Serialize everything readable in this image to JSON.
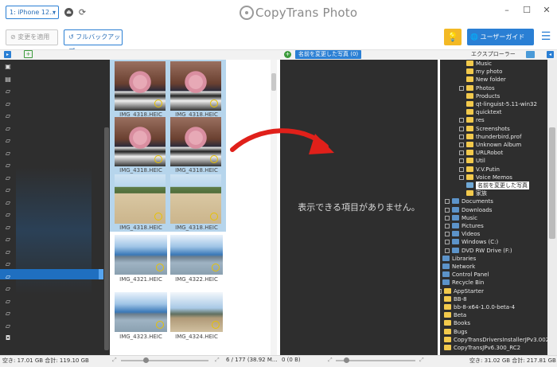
{
  "titlebar": {
    "device_selector": "1: iPhone 12...",
    "app_title": "CopyTrans Photo"
  },
  "toolbar": {
    "apply_changes": "変更を適用",
    "full_backup": "フルバックアップ",
    "user_guide": "ユーザーガイド"
  },
  "headers": {
    "renamed_photos_tab": "名前を変更した写真",
    "renamed_photos_count": "(0)",
    "explorer_label": "エクスプローラー"
  },
  "photos": [
    {
      "name": "IMG_4318.HEIC",
      "type": "flowers",
      "selected": true
    },
    {
      "name": "IMG_4318.HEIC",
      "type": "flowers",
      "selected": true
    },
    {
      "name": "IMG_4318.HEIC",
      "type": "flowers",
      "selected": true
    },
    {
      "name": "IMG_4318.HEIC",
      "type": "flowers",
      "selected": true
    },
    {
      "name": "IMG_4318.HEIC",
      "type": "beach",
      "selected": true
    },
    {
      "name": "IMG_4318.HEIC",
      "type": "beach",
      "selected": true
    },
    {
      "name": "IMG_4321.HEIC",
      "type": "sea",
      "selected": false
    },
    {
      "name": "IMG_4322.HEIC",
      "type": "sea",
      "selected": false
    },
    {
      "name": "IMG_4323.HEIC",
      "type": "sea",
      "selected": false
    },
    {
      "name": "IMG_4324.HEIC",
      "type": "path",
      "selected": false
    }
  ],
  "center": {
    "empty_message": "表示できる項目がありません。"
  },
  "explorer_tree": [
    {
      "label": "Music",
      "icon": "folder"
    },
    {
      "label": "my photo",
      "icon": "folder"
    },
    {
      "label": "New folder",
      "icon": "folder"
    },
    {
      "label": "Photos",
      "icon": "folder"
    },
    {
      "label": "Products",
      "icon": "folder"
    },
    {
      "label": "qt-linguist-5.11-win32",
      "icon": "folder"
    },
    {
      "label": "quicktext",
      "icon": "folder"
    },
    {
      "label": "res",
      "icon": "folder"
    },
    {
      "label": "Screenshots",
      "icon": "folder"
    },
    {
      "label": "thunderbird.prof",
      "icon": "folder"
    },
    {
      "label": "Unknown Album",
      "icon": "folder"
    },
    {
      "label": "URLRobot",
      "icon": "folder"
    },
    {
      "label": "Util",
      "icon": "folder"
    },
    {
      "label": "V.V.Putin",
      "icon": "folder"
    },
    {
      "label": "Voice Memos",
      "icon": "folder"
    },
    {
      "label": "名前を変更した写真",
      "icon": "folder-special",
      "selected": true
    },
    {
      "label": "家族",
      "icon": "folder"
    },
    {
      "label": "Documents",
      "icon": "documents"
    },
    {
      "label": "Downloads",
      "icon": "downloads"
    },
    {
      "label": "Music",
      "icon": "music"
    },
    {
      "label": "Pictures",
      "icon": "pictures"
    },
    {
      "label": "Videos",
      "icon": "videos"
    },
    {
      "label": "Windows (C:)",
      "icon": "drive"
    },
    {
      "label": "DVD RW Drive (F:)",
      "icon": "dvd"
    },
    {
      "label": "Libraries",
      "icon": "libraries"
    },
    {
      "label": "Network",
      "icon": "network"
    },
    {
      "label": "Control Panel",
      "icon": "control-panel"
    },
    {
      "label": "Recycle Bin",
      "icon": "recycle-bin"
    },
    {
      "label": "AppStarter",
      "icon": "folder"
    },
    {
      "label": "BB-8",
      "icon": "folder"
    },
    {
      "label": "bb-8-x64-1.0.0-beta-4",
      "icon": "folder"
    },
    {
      "label": "Beta",
      "icon": "folder"
    },
    {
      "label": "Books",
      "icon": "folder"
    },
    {
      "label": "Bugs",
      "icon": "folder"
    },
    {
      "label": "CopyTransDriversInstallerJPv3.002",
      "icon": "folder"
    },
    {
      "label": "CopyTransJPv6.300_RC2",
      "icon": "folder"
    }
  ],
  "status": {
    "left_free": "空き: 17.01 GB 合計: 119.10 GB",
    "photo_count": "6 / 177 (38.92 M...",
    "center_count": "0 (0 B)",
    "right_free": "空き: 31.02 GB 合計: 217.81 GB"
  },
  "colors": {
    "accent_blue": "#2a7fd4",
    "dark_panel": "#2e2e2e",
    "selection_bg": "#b6d5ec",
    "tip_yellow": "#f3b925",
    "arrow_red": "#e0201a"
  }
}
